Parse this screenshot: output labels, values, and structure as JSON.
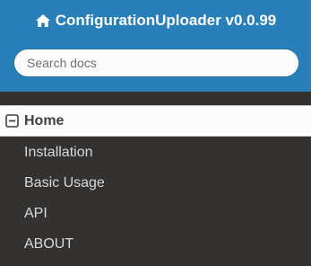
{
  "header": {
    "brand_text": "ConfigurationUploader v0.0.99",
    "brand_icon": "home-icon",
    "background_color": "#2980b9"
  },
  "search": {
    "placeholder": "Search docs",
    "value": ""
  },
  "nav": {
    "current": {
      "label": "Home",
      "icon": "minus-square-icon"
    },
    "items": [
      {
        "label": "Installation"
      },
      {
        "label": "Basic Usage"
      },
      {
        "label": "API"
      },
      {
        "label": "ABOUT"
      }
    ]
  }
}
